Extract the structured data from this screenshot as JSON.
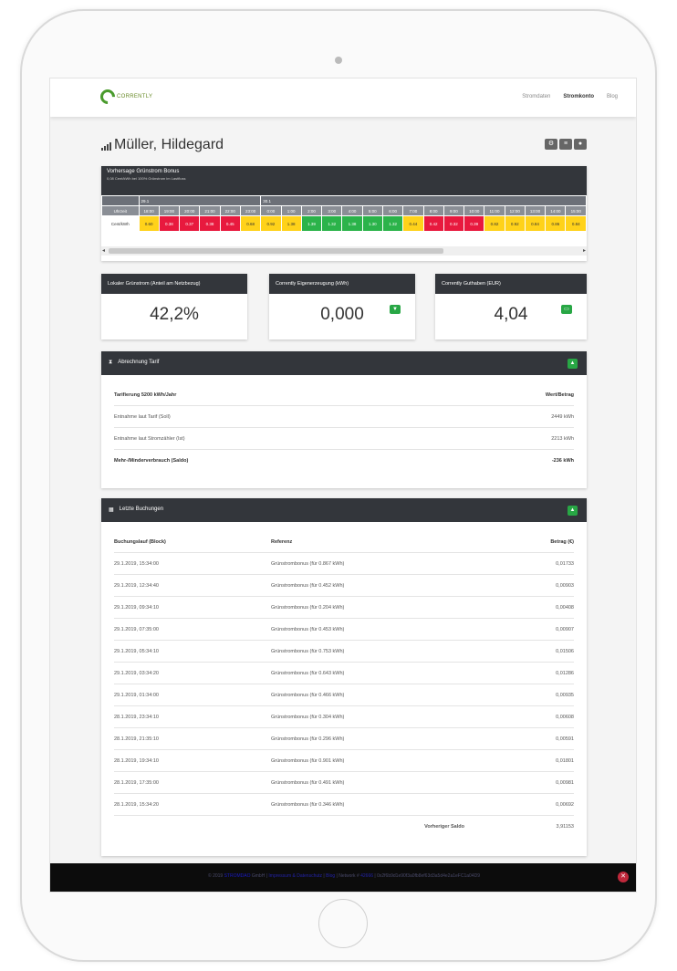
{
  "header": {
    "logo_text": "CORRENTLY",
    "nav": [
      "Stromdaten",
      "Stromkonto",
      "Blog"
    ]
  },
  "page_title": "Müller, Hildegard",
  "title_action_icons": [
    "gear-icon",
    "list-icon",
    "user-icon"
  ],
  "forecast": {
    "title": "Vorhersage Grünstrom Bonus",
    "subtitle": "0,08 Cent/kWh bei 100% Grünstrom im Lastfluss",
    "dates": [
      "29.1",
      "30.1"
    ],
    "hours": [
      "Uhrzeit",
      "18:00",
      "19:00",
      "20:00",
      "21:00",
      "22:00",
      "23:00",
      "0:00",
      "1:00",
      "2:00",
      "3:00",
      "4:00",
      "5:00",
      "6:00",
      "7:00",
      "8:00",
      "9:00",
      "10:00",
      "11:00",
      "12:00",
      "13:00",
      "14:00",
      "15:00"
    ],
    "row_label": "Cent/kWh",
    "values": [
      "0.60",
      "0.38",
      "0.37",
      "0.38",
      "0.45",
      "0.68",
      "0.92",
      "1.38",
      "1.39",
      "1.32",
      "1.38",
      "1.30",
      "1.32",
      "0.44",
      "0.42",
      "0.32",
      "0.39",
      "0.82",
      "0.92",
      "0.84",
      "0.86",
      "0.84"
    ],
    "value_colors": [
      "y",
      "r",
      "r",
      "r",
      "r",
      "y",
      "y",
      "y",
      "g",
      "g",
      "g",
      "g",
      "g",
      "y",
      "r",
      "r",
      "r",
      "y",
      "y",
      "y",
      "y",
      "y"
    ],
    "scroll_position": 0.69
  },
  "kpis": [
    {
      "title": "Lokaler Grünstrom (Anteil am Netzbezug)",
      "value": "42,2%",
      "badge": ""
    },
    {
      "title": "Corrently Eigenerzeugung (kWh)",
      "value": "0,000",
      "badge": "▼"
    },
    {
      "title": "Corrently Guthaben (EUR)",
      "value": "4,04",
      "badge": "▭"
    }
  ],
  "abrechnung": {
    "title": "Abrechnung Tarif",
    "badge": "▲",
    "header": {
      "label": "Tarifierung 5200 kWh/Jahr",
      "value": "Wert/Betrag"
    },
    "rows": [
      {
        "label": "Entnahme laut Tarif (Soll)",
        "value": "2449 kWh"
      },
      {
        "label": "Entnahme laut Stromzähler (Ist)",
        "value": "2213 kWh"
      }
    ],
    "footer": {
      "label": "Mehr-/Minderverbrauch (Saldo)",
      "value": "-236 kWh"
    }
  },
  "buchungen": {
    "title": "Letzte Buchungen",
    "badge": "▲",
    "columns": [
      "Buchungslauf (Block)",
      "Referenz",
      "Betrag (€)"
    ],
    "rows": [
      {
        "time": "29.1.2019, 15:34:00",
        "ref": "Grünstrombonus (für 0.867 kWh)",
        "amount": "0,01733"
      },
      {
        "time": "29.1.2019, 12:34:40",
        "ref": "Grünstrombonus (für 0.452 kWh)",
        "amount": "0,00903"
      },
      {
        "time": "29.1.2019, 09:34:10",
        "ref": "Grünstrombonus (für 0.204 kWh)",
        "amount": "0,00408"
      },
      {
        "time": "29.1.2019, 07:35:00",
        "ref": "Grünstrombonus (für 0.453 kWh)",
        "amount": "0,00907"
      },
      {
        "time": "29.1.2019, 05:34:10",
        "ref": "Grünstrombonus (für 0.753 kWh)",
        "amount": "0,01506"
      },
      {
        "time": "29.1.2019, 03:34:20",
        "ref": "Grünstrombonus (für 0.643 kWh)",
        "amount": "0,01286"
      },
      {
        "time": "29.1.2019, 01:34:00",
        "ref": "Grünstrombonus (für 0.466 kWh)",
        "amount": "0,00935"
      },
      {
        "time": "28.1.2019, 23:34:10",
        "ref": "Grünstrombonus (für 0.304 kWh)",
        "amount": "0,00608"
      },
      {
        "time": "28.1.2019, 21:35:10",
        "ref": "Grünstrombonus (für 0.296 kWh)",
        "amount": "0,00591"
      },
      {
        "time": "28.1.2019, 19:34:10",
        "ref": "Grünstrombonus (für 0.901 kWh)",
        "amount": "0,01801"
      },
      {
        "time": "28.1.2019, 17:35:00",
        "ref": "Grünstrombonus (für 0.491 kWh)",
        "amount": "0,00981"
      },
      {
        "time": "28.1.2019, 15:34:20",
        "ref": "Grünstrombonus (für 0.346 kWh)",
        "amount": "0,00692"
      }
    ],
    "footer": {
      "label": "Vorheriger Saldo",
      "value": "3,91153"
    }
  },
  "footer": {
    "prefix": "© 2019",
    "brand": "STROMDAO",
    "company": "GmbH",
    "sep1": " | ",
    "link1": "Impressum & Datenschutz",
    "sep2": " | ",
    "link2": "Blog",
    "sep3": " | ",
    "version_label": "Network #",
    "version": "42666",
    "sep4": " | ",
    "hash": "0x2f6b9d1e90f3a0fb8ef63d3a5d4e2a1eFC1a04D9"
  }
}
